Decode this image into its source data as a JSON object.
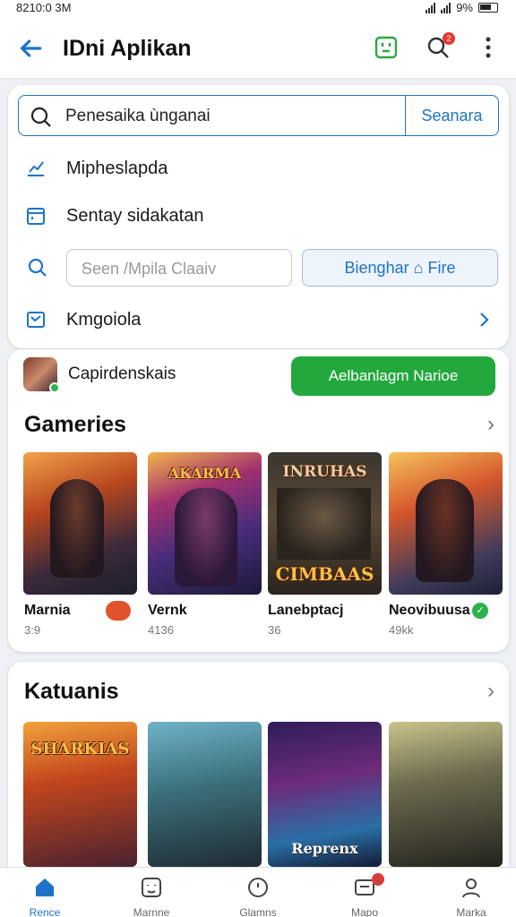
{
  "status": {
    "time": "8210:0 3M",
    "battery": "9%"
  },
  "appbar": {
    "title": "IDni Aplikan",
    "notif_count": "2"
  },
  "search": {
    "value": "Penesaika ùnganai",
    "button": "Seanara"
  },
  "menu": {
    "item1": "Mipheslapda",
    "item2": "Sentay sidakatan",
    "input_placeholder": "Seen /Mpila Claaiv",
    "action_button": "Bienghar ⌂ Fire",
    "item4": "Kmgoiola"
  },
  "app": {
    "name": "Capirdenskais",
    "install": "Aelbanlagm Narioe"
  },
  "section1": {
    "title": "Gameries",
    "games": [
      {
        "name": "Marnia",
        "sub": "3:9",
        "badge": ""
      },
      {
        "name": "Vernk",
        "sub": "4136",
        "badge": ""
      },
      {
        "name": "Lanebptacj",
        "sub": "36",
        "badge": ""
      },
      {
        "name": "Neovibuusa",
        "sub": "49kk",
        "badge": ""
      }
    ],
    "thumb_titles": [
      "",
      "AKARMA",
      "INRUHAS",
      ""
    ],
    "thumb_titles2": [
      "",
      "",
      "CIMBAAS",
      ""
    ]
  },
  "section2": {
    "title": "Katuanis",
    "thumb_titles": [
      "SHARKIAS",
      "",
      "",
      ""
    ],
    "thumb_titles_bottom": [
      "",
      "",
      "Reprenx",
      ""
    ]
  },
  "tabs": [
    {
      "label": "Rence",
      "icon": "home-icon"
    },
    {
      "label": "Marnne",
      "icon": "face-icon"
    },
    {
      "label": "Glamns",
      "icon": "compass-icon"
    },
    {
      "label": "Mapo",
      "icon": "inbox-icon",
      "badge": "1"
    },
    {
      "label": "Marka",
      "icon": "person-icon"
    }
  ],
  "colors": {
    "accent": "#1e73c8",
    "install": "#22a83d",
    "badge": "#e53935"
  }
}
